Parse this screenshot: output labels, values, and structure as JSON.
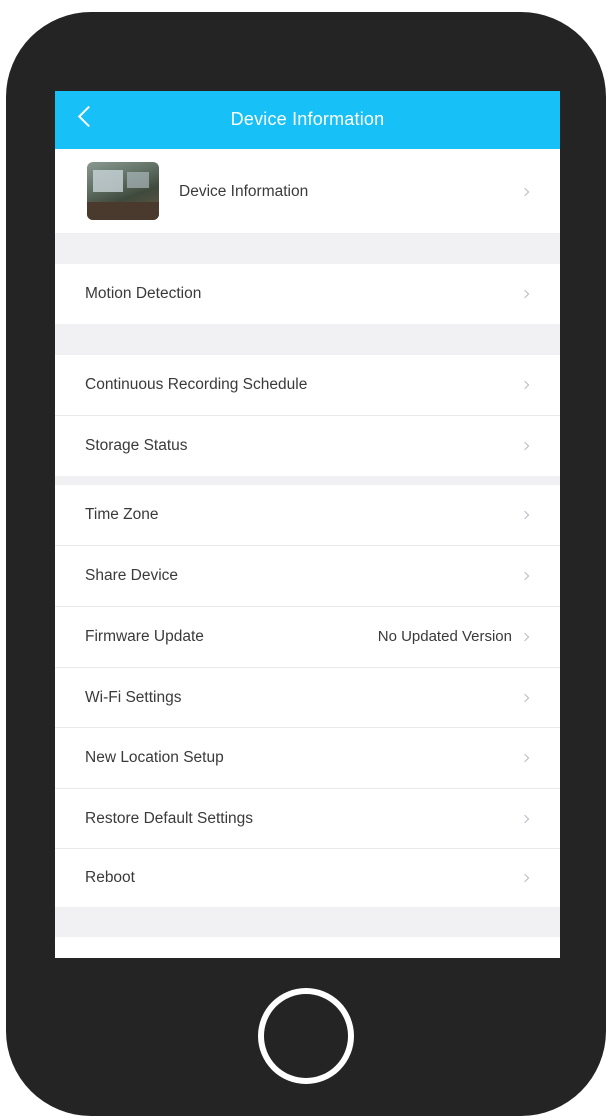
{
  "header": {
    "title": "Device Information"
  },
  "device": {
    "name": "Device Information"
  },
  "items": [
    {
      "label": "Motion Detection"
    },
    {
      "label": "Continuous Recording Schedule"
    },
    {
      "label": "Storage Status"
    },
    {
      "label": "Time Zone"
    },
    {
      "label": "Share Device"
    },
    {
      "label": "Firmware Update",
      "value": "No Updated Version"
    },
    {
      "label": "Wi-Fi Settings"
    },
    {
      "label": "New Location Setup"
    },
    {
      "label": "Restore Default Settings"
    },
    {
      "label": "Reboot"
    }
  ],
  "colors": {
    "header": "#17c1f7",
    "phone": "#242424",
    "background": "#f1f1f3"
  }
}
